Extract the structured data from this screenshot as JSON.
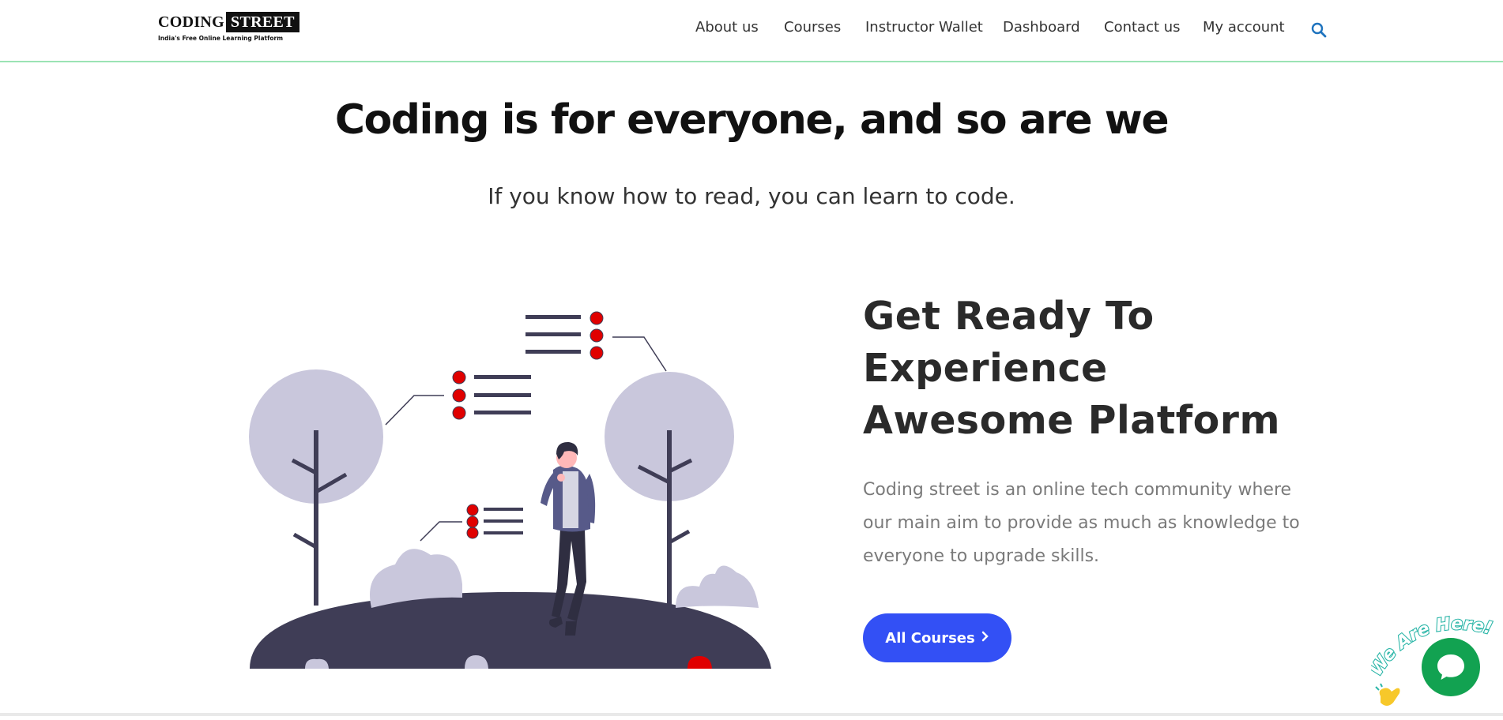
{
  "logo": {
    "coding": "CODING",
    "street": "STREET",
    "tagline": "India's Free Online Learning Platform"
  },
  "nav": {
    "items": [
      "About us",
      "Courses",
      "Instructor Wallet",
      "Dashboard",
      "Contact us",
      "My account"
    ],
    "search_icon": "search-icon"
  },
  "hero": {
    "title": "Coding is for everyone, and so are we",
    "subtitle": "If you know how to read, you can learn to code."
  },
  "feature": {
    "title_lines": [
      "Get Ready To",
      "Experience",
      "Awesome Platform"
    ],
    "description": "Coding street is an online tech community where our main aim to provide as much as knowledge to everyone to upgrade skills.",
    "button_label": "All Courses",
    "button_icon": "chevron-right-icon"
  },
  "chat": {
    "label": "We Are Here!",
    "icon": "chat-icon"
  },
  "colors": {
    "accent_blue": "#3350f5",
    "chat_green": "#12a251",
    "header_border": "#9be3b4",
    "illustration_dark": "#3f3d56",
    "illustration_light": "#c9c7dc",
    "illustration_red": "#e00000"
  }
}
